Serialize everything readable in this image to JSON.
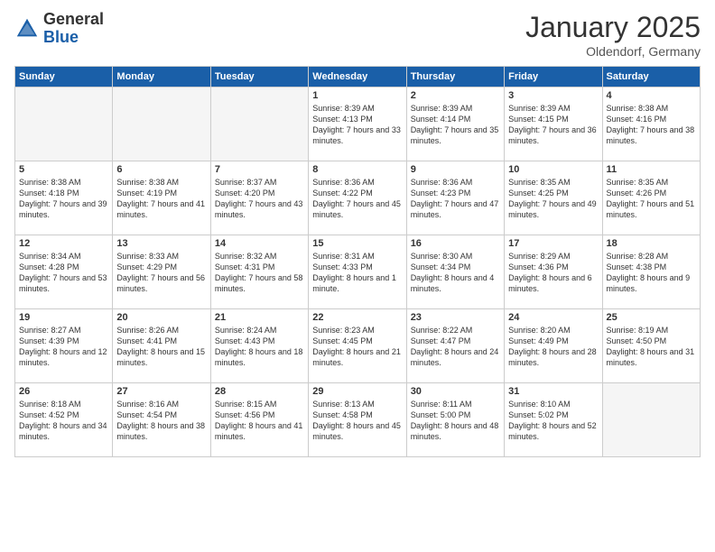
{
  "logo": {
    "general": "General",
    "blue": "Blue"
  },
  "title": "January 2025",
  "location": "Oldendorf, Germany",
  "days_of_week": [
    "Sunday",
    "Monday",
    "Tuesday",
    "Wednesday",
    "Thursday",
    "Friday",
    "Saturday"
  ],
  "weeks": [
    [
      {
        "day": "",
        "content": ""
      },
      {
        "day": "",
        "content": ""
      },
      {
        "day": "",
        "content": ""
      },
      {
        "day": "1",
        "content": "Sunrise: 8:39 AM\nSunset: 4:13 PM\nDaylight: 7 hours\nand 33 minutes."
      },
      {
        "day": "2",
        "content": "Sunrise: 8:39 AM\nSunset: 4:14 PM\nDaylight: 7 hours\nand 35 minutes."
      },
      {
        "day": "3",
        "content": "Sunrise: 8:39 AM\nSunset: 4:15 PM\nDaylight: 7 hours\nand 36 minutes."
      },
      {
        "day": "4",
        "content": "Sunrise: 8:38 AM\nSunset: 4:16 PM\nDaylight: 7 hours\nand 38 minutes."
      }
    ],
    [
      {
        "day": "5",
        "content": "Sunrise: 8:38 AM\nSunset: 4:18 PM\nDaylight: 7 hours\nand 39 minutes."
      },
      {
        "day": "6",
        "content": "Sunrise: 8:38 AM\nSunset: 4:19 PM\nDaylight: 7 hours\nand 41 minutes."
      },
      {
        "day": "7",
        "content": "Sunrise: 8:37 AM\nSunset: 4:20 PM\nDaylight: 7 hours\nand 43 minutes."
      },
      {
        "day": "8",
        "content": "Sunrise: 8:36 AM\nSunset: 4:22 PM\nDaylight: 7 hours\nand 45 minutes."
      },
      {
        "day": "9",
        "content": "Sunrise: 8:36 AM\nSunset: 4:23 PM\nDaylight: 7 hours\nand 47 minutes."
      },
      {
        "day": "10",
        "content": "Sunrise: 8:35 AM\nSunset: 4:25 PM\nDaylight: 7 hours\nand 49 minutes."
      },
      {
        "day": "11",
        "content": "Sunrise: 8:35 AM\nSunset: 4:26 PM\nDaylight: 7 hours\nand 51 minutes."
      }
    ],
    [
      {
        "day": "12",
        "content": "Sunrise: 8:34 AM\nSunset: 4:28 PM\nDaylight: 7 hours\nand 53 minutes."
      },
      {
        "day": "13",
        "content": "Sunrise: 8:33 AM\nSunset: 4:29 PM\nDaylight: 7 hours\nand 56 minutes."
      },
      {
        "day": "14",
        "content": "Sunrise: 8:32 AM\nSunset: 4:31 PM\nDaylight: 7 hours\nand 58 minutes."
      },
      {
        "day": "15",
        "content": "Sunrise: 8:31 AM\nSunset: 4:33 PM\nDaylight: 8 hours\nand 1 minute."
      },
      {
        "day": "16",
        "content": "Sunrise: 8:30 AM\nSunset: 4:34 PM\nDaylight: 8 hours\nand 4 minutes."
      },
      {
        "day": "17",
        "content": "Sunrise: 8:29 AM\nSunset: 4:36 PM\nDaylight: 8 hours\nand 6 minutes."
      },
      {
        "day": "18",
        "content": "Sunrise: 8:28 AM\nSunset: 4:38 PM\nDaylight: 8 hours\nand 9 minutes."
      }
    ],
    [
      {
        "day": "19",
        "content": "Sunrise: 8:27 AM\nSunset: 4:39 PM\nDaylight: 8 hours\nand 12 minutes."
      },
      {
        "day": "20",
        "content": "Sunrise: 8:26 AM\nSunset: 4:41 PM\nDaylight: 8 hours\nand 15 minutes."
      },
      {
        "day": "21",
        "content": "Sunrise: 8:24 AM\nSunset: 4:43 PM\nDaylight: 8 hours\nand 18 minutes."
      },
      {
        "day": "22",
        "content": "Sunrise: 8:23 AM\nSunset: 4:45 PM\nDaylight: 8 hours\nand 21 minutes."
      },
      {
        "day": "23",
        "content": "Sunrise: 8:22 AM\nSunset: 4:47 PM\nDaylight: 8 hours\nand 24 minutes."
      },
      {
        "day": "24",
        "content": "Sunrise: 8:20 AM\nSunset: 4:49 PM\nDaylight: 8 hours\nand 28 minutes."
      },
      {
        "day": "25",
        "content": "Sunrise: 8:19 AM\nSunset: 4:50 PM\nDaylight: 8 hours\nand 31 minutes."
      }
    ],
    [
      {
        "day": "26",
        "content": "Sunrise: 8:18 AM\nSunset: 4:52 PM\nDaylight: 8 hours\nand 34 minutes."
      },
      {
        "day": "27",
        "content": "Sunrise: 8:16 AM\nSunset: 4:54 PM\nDaylight: 8 hours\nand 38 minutes."
      },
      {
        "day": "28",
        "content": "Sunrise: 8:15 AM\nSunset: 4:56 PM\nDaylight: 8 hours\nand 41 minutes."
      },
      {
        "day": "29",
        "content": "Sunrise: 8:13 AM\nSunset: 4:58 PM\nDaylight: 8 hours\nand 45 minutes."
      },
      {
        "day": "30",
        "content": "Sunrise: 8:11 AM\nSunset: 5:00 PM\nDaylight: 8 hours\nand 48 minutes."
      },
      {
        "day": "31",
        "content": "Sunrise: 8:10 AM\nSunset: 5:02 PM\nDaylight: 8 hours\nand 52 minutes."
      },
      {
        "day": "",
        "content": ""
      }
    ]
  ]
}
